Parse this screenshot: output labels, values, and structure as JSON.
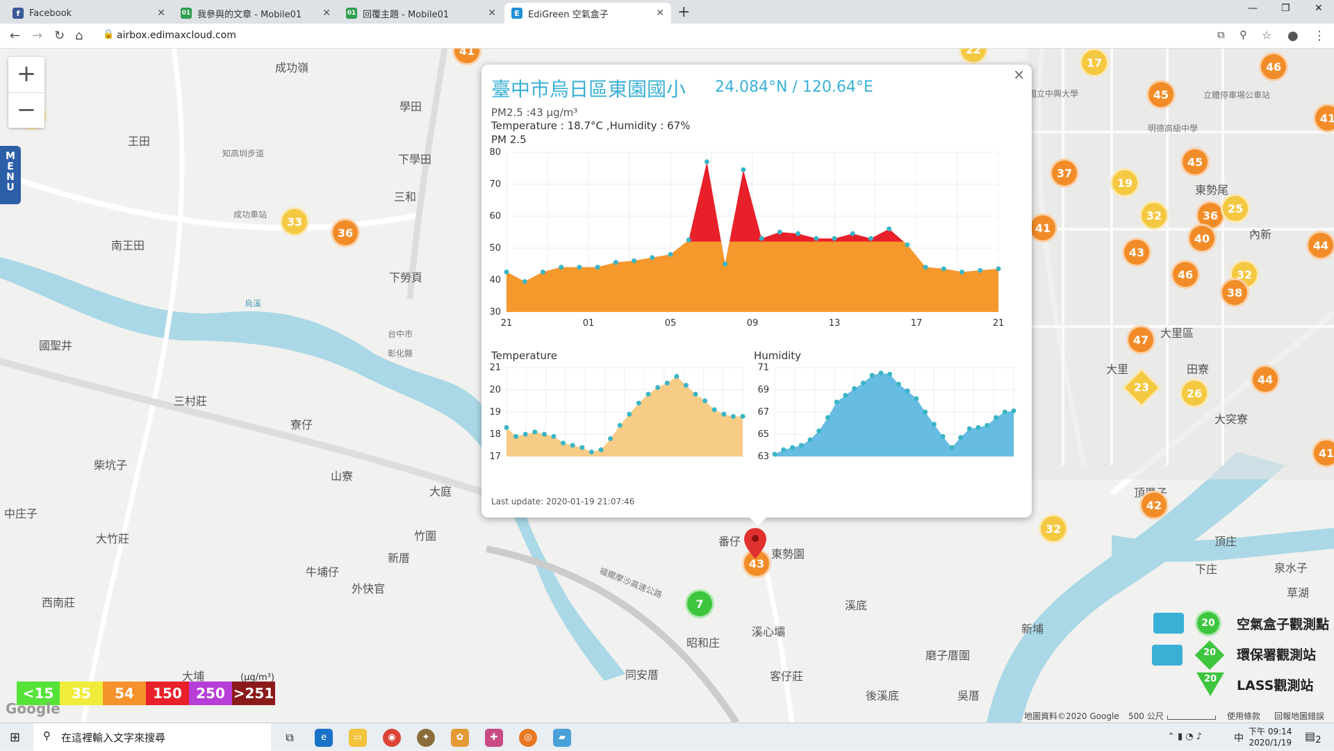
{
  "tabs": [
    {
      "label": "Facebook",
      "icon": "facebook-icon",
      "color": "#3b5998",
      "glyph": "f"
    },
    {
      "label": "我參與的文章 - Mobile01",
      "icon": "mobile01-icon",
      "color": "#2e9e4f",
      "glyph": "01"
    },
    {
      "label": "回覆主題 - Mobile01",
      "icon": "mobile01-icon",
      "color": "#2e9e4f",
      "glyph": "01"
    },
    {
      "label": "EdiGreen 空氣盒子",
      "icon": "edigreen-icon",
      "color": "#1e8fd6",
      "glyph": "E"
    }
  ],
  "url": "airbox.edimaxcloud.com",
  "map": {
    "zoom_in": "+",
    "zoom_out": "−",
    "menu_label": "MENU",
    "places": [
      {
        "t": "成功嶺"
      },
      {
        "t": "王田"
      },
      {
        "t": "知高圳步道"
      },
      {
        "t": "成功車站"
      },
      {
        "t": "學田"
      },
      {
        "t": "下學田"
      },
      {
        "t": "三和"
      },
      {
        "t": "南王田"
      },
      {
        "t": "下勞頁"
      },
      {
        "t": "國聖井"
      },
      {
        "t": "三村莊"
      },
      {
        "t": "寮仔"
      },
      {
        "t": "柴坑子"
      },
      {
        "t": "山寮"
      },
      {
        "t": "大庭"
      },
      {
        "t": "中庄子"
      },
      {
        "t": "大竹莊"
      },
      {
        "t": "竹圍"
      },
      {
        "t": "新厝"
      },
      {
        "t": "牛埔仔"
      },
      {
        "t": "外快官"
      },
      {
        "t": "西南莊"
      },
      {
        "t": "番仔"
      },
      {
        "t": "東勢園"
      },
      {
        "t": "溪底"
      },
      {
        "t": "溪心壩"
      },
      {
        "t": "昭和庄"
      },
      {
        "t": "同安厝"
      },
      {
        "t": "客仔莊"
      },
      {
        "t": "大埔"
      },
      {
        "t": "新埔"
      },
      {
        "t": "磨子厝圍"
      },
      {
        "t": "後溪底"
      },
      {
        "t": "吳厝"
      },
      {
        "t": "大里區"
      },
      {
        "t": "大里"
      },
      {
        "t": "田寮"
      },
      {
        "t": "大突寮"
      },
      {
        "t": "頂厝子"
      },
      {
        "t": "內新"
      },
      {
        "t": "東勢尾"
      },
      {
        "t": "立體停車場公車站"
      },
      {
        "t": "明德高級中學"
      },
      {
        "t": "國立中興大學"
      },
      {
        "t": "頂庄"
      },
      {
        "t": "泉水子"
      },
      {
        "t": "草湖"
      },
      {
        "t": "下庄"
      },
      {
        "t": "福爾摩沙高速公路"
      },
      {
        "t": "烏溪"
      },
      {
        "t": "台中市"
      },
      {
        "t": "彰化縣"
      }
    ],
    "markers": [
      {
        "v": "41",
        "c": "orange"
      },
      {
        "v": "26",
        "c": "yellow"
      },
      {
        "v": "33",
        "c": "yellow"
      },
      {
        "v": "36",
        "c": "orange"
      },
      {
        "v": "22",
        "c": "yellow"
      },
      {
        "v": "17",
        "c": "yellow"
      },
      {
        "v": "46",
        "c": "orange"
      },
      {
        "v": "45",
        "c": "orange"
      },
      {
        "v": "41",
        "c": "orange"
      },
      {
        "v": "37",
        "c": "orange"
      },
      {
        "v": "19",
        "c": "yellow"
      },
      {
        "v": "45",
        "c": "orange"
      },
      {
        "v": "32",
        "c": "yellow"
      },
      {
        "v": "36",
        "c": "orange"
      },
      {
        "v": "25",
        "c": "yellow"
      },
      {
        "v": "41",
        "c": "orange"
      },
      {
        "v": "40",
        "c": "orange"
      },
      {
        "v": "44",
        "c": "orange"
      },
      {
        "v": "43",
        "c": "orange"
      },
      {
        "v": "46",
        "c": "orange"
      },
      {
        "v": "32",
        "c": "yellow"
      },
      {
        "v": "38",
        "c": "orange"
      },
      {
        "v": "47",
        "c": "orange"
      },
      {
        "v": "44",
        "c": "orange"
      },
      {
        "v": "26",
        "c": "yellow"
      },
      {
        "v": "41",
        "c": "orange"
      },
      {
        "v": "42",
        "c": "orange"
      },
      {
        "v": "32",
        "c": "yellow"
      },
      {
        "v": "43",
        "c": "orange"
      },
      {
        "v": "7",
        "c": "green"
      }
    ],
    "diamond_marker": "23",
    "map_legend": [
      {
        "value": "20",
        "label": "空氣盒子觀測點"
      },
      {
        "value": "20",
        "label": "環保署觀測站"
      },
      {
        "value": "20",
        "label": "LASS觀測站"
      }
    ],
    "scale": [
      {
        "label": "<15",
        "color": "#55e33a"
      },
      {
        "label": "35",
        "color": "#f0ec3b"
      },
      {
        "label": "54",
        "color": "#f5922b"
      },
      {
        "label": "150",
        "color": "#e8202a"
      },
      {
        "label": "250",
        "color": "#b83ed8"
      },
      {
        "label": ">251",
        "color": "#8b1a1a"
      }
    ],
    "unit": "(μg/m³)",
    "attrib": "地圖資料©2020 Google",
    "scale_text": "500 公尺",
    "terms": "使用條款",
    "report": "回報地圖錯誤",
    "google": "Google"
  },
  "popup": {
    "title": "臺中市烏日區東園國小",
    "coords": "24.084°N / 120.64°E",
    "pm_line": "PM2.5 :43 μg/m³",
    "temp_line": "Temperature : 18.7°C ,Humidity : 67%",
    "pm_label": "PM 2.5",
    "temp_label": "Temperature",
    "hum_label": "Humidity",
    "last_update": "Last update: 2020-01-19 21:07:46",
    "close": "×"
  },
  "chart_data": [
    {
      "type": "area",
      "title": "PM 2.5",
      "x": [
        "21",
        "",
        "",
        "",
        "01",
        "",
        "",
        "",
        "05",
        "",
        "",
        "",
        "09",
        "",
        "",
        "",
        "13",
        "",
        "",
        "",
        "17",
        "",
        "",
        "",
        "21"
      ],
      "xticks": [
        "21",
        "01",
        "05",
        "09",
        "13",
        "17",
        "21"
      ],
      "ylim": [
        30,
        80
      ],
      "yticks": [
        30,
        40,
        50,
        60,
        70,
        80
      ],
      "values": [
        42.5,
        39.5,
        42.5,
        44,
        44,
        44,
        45.5,
        46,
        47,
        48,
        52.5,
        77,
        45,
        74.5,
        53,
        55,
        54.5,
        53,
        53,
        54.5,
        53,
        56,
        51,
        44,
        43.5,
        42.5,
        43,
        43.5
      ],
      "threshold": 52,
      "colors": {
        "low": "#f5992c",
        "high": "#e8202a",
        "dot": "#3ab5c5"
      }
    },
    {
      "type": "area",
      "title": "Temperature",
      "ylim": [
        17,
        21
      ],
      "yticks": [
        17,
        18,
        19,
        20,
        21
      ],
      "values": [
        18.3,
        17.9,
        18.0,
        18.1,
        18.0,
        17.9,
        17.6,
        17.5,
        17.4,
        17.2,
        17.3,
        17.8,
        18.4,
        18.9,
        19.4,
        19.8,
        20.1,
        20.3,
        20.6,
        20.2,
        19.8,
        19.5,
        19.1,
        18.9,
        18.8,
        18.8
      ],
      "colors": {
        "fill": "#f6c77a",
        "dot": "#3ab5c5"
      }
    },
    {
      "type": "area",
      "title": "Humidity",
      "ylim": [
        63,
        71
      ],
      "yticks": [
        63,
        65,
        67,
        69,
        71
      ],
      "values": [
        63.2,
        63.6,
        63.8,
        64.0,
        64.5,
        65.3,
        66.5,
        67.9,
        68.5,
        69.1,
        69.6,
        70.3,
        70.5,
        70.4,
        69.5,
        68.9,
        68.2,
        67.0,
        65.9,
        64.8,
        63.8,
        64.7,
        65.5,
        65.6,
        65.8,
        66.5,
        67.0,
        67.1
      ],
      "colors": {
        "fill": "#56b5e0",
        "dot": "#3ab5c5"
      }
    }
  ],
  "taskbar": {
    "search_placeholder": "在這裡輸入文字來搜尋",
    "time": "下午 09:14",
    "date": "2020/1/19",
    "notif": "2",
    "ime": "中"
  }
}
